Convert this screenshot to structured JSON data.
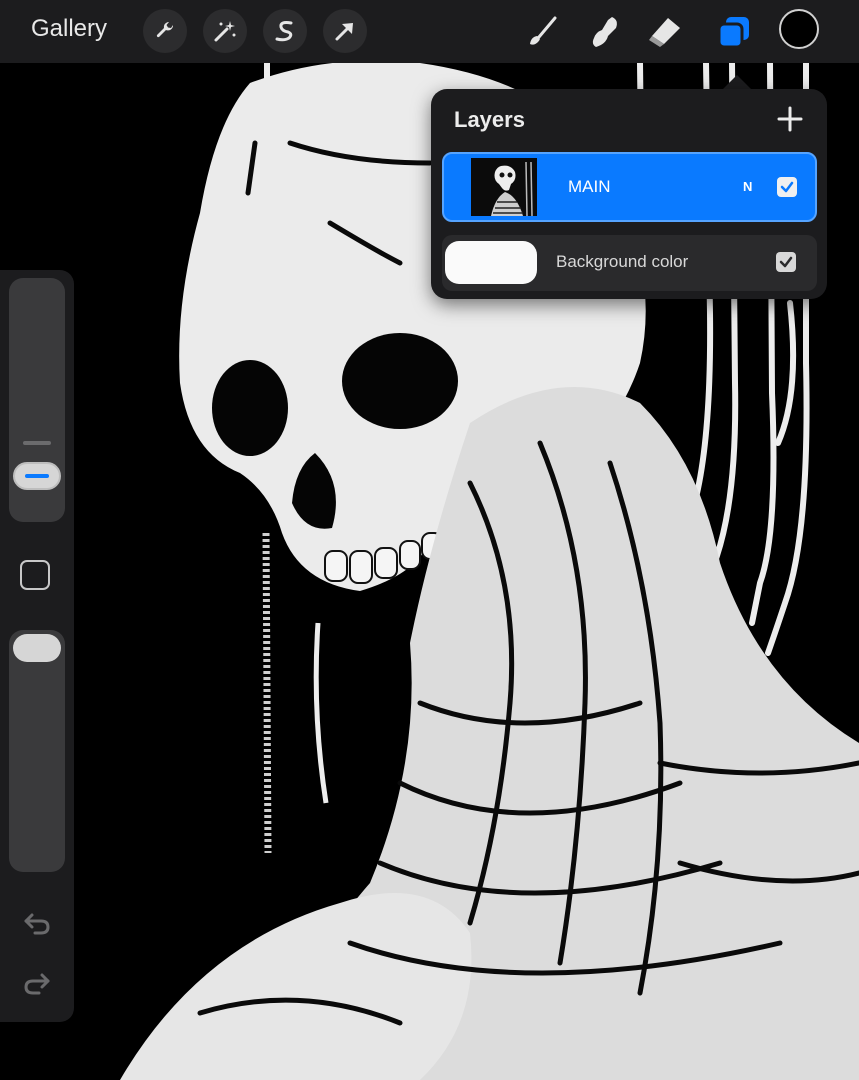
{
  "topbar": {
    "gallery_label": "Gallery",
    "actions": [
      "wrench-icon",
      "magic-wand-icon",
      "selection-icon",
      "transform-arrow-icon"
    ],
    "tools": [
      "brush-icon",
      "smudge-icon",
      "eraser-icon",
      "layers-icon"
    ],
    "active_tool": "layers-icon",
    "accent_color": "#0a7aff",
    "current_color": "#000000"
  },
  "layers_panel": {
    "title": "Layers",
    "add_label": "+",
    "layers": [
      {
        "name": "MAIN",
        "blend_mode": "N",
        "visible": true,
        "selected": true
      },
      {
        "name": "Background color",
        "visible": true,
        "selected": false
      }
    ]
  },
  "sidebar": {
    "brush_size_level": 0.2,
    "opacity_level": 1.0
  }
}
